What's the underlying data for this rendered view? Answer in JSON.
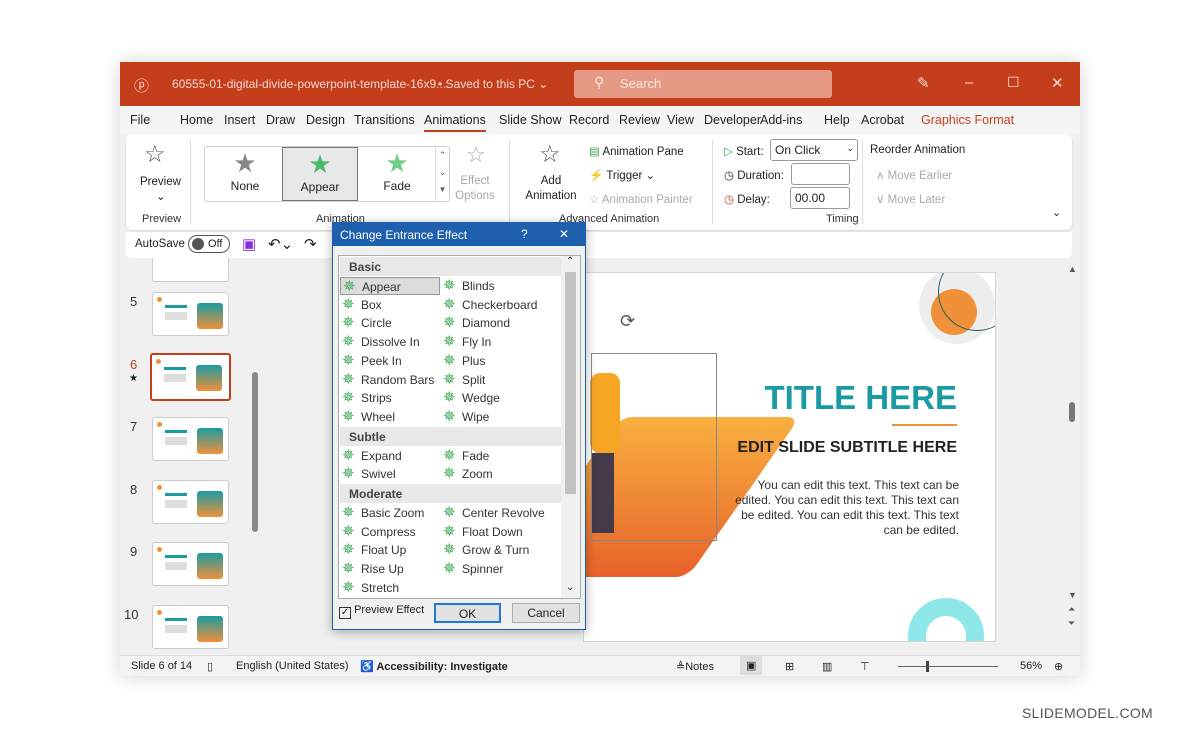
{
  "titlebar": {
    "filename": "60555-01-digital-divide-powerpoint-template-16x9....",
    "saved": "• Saved to this PC ⌄",
    "search_placeholder": "Search",
    "accent": "#c43e1c"
  },
  "tabs": [
    "File",
    "Home",
    "Insert",
    "Draw",
    "Design",
    "Transitions",
    "Animations",
    "Slide Show",
    "Record",
    "Review",
    "View",
    "Developer",
    "Add-ins",
    "Help",
    "Acrobat",
    "Graphics Format"
  ],
  "active_tab": "Animations",
  "ribbon": {
    "preview": {
      "label": "Preview",
      "group": "Preview"
    },
    "gallery": [
      {
        "label": "None"
      },
      {
        "label": "Appear",
        "selected": true
      },
      {
        "label": "Fade"
      }
    ],
    "effect_options": "Effect Options",
    "animation_group": "Animation",
    "add_animation": "Add Animation",
    "animation_pane": "Animation Pane",
    "trigger": "Trigger",
    "animation_painter": "Animation Painter",
    "advanced_group": "Advanced Animation",
    "start_label": "Start:",
    "start_value": "On Click",
    "duration_label": "Duration:",
    "duration_value": "",
    "delay_label": "Delay:",
    "delay_value": "00.00",
    "timing_group": "Timing",
    "reorder": "Reorder Animation",
    "move_earlier": "Move Earlier",
    "move_later": "Move Later"
  },
  "qat": {
    "autosave": "AutoSave",
    "toggle": "Off"
  },
  "thumbnails": [
    {
      "num": "5"
    },
    {
      "num": "6",
      "selected": true,
      "star": "★"
    },
    {
      "num": "7"
    },
    {
      "num": "8"
    },
    {
      "num": "9"
    },
    {
      "num": "10"
    }
  ],
  "slide": {
    "title": "TITLE HERE",
    "subtitle": "EDIT SLIDE SUBTITLE HERE",
    "body": "You can edit this text. This text can be edited. You can edit this text. This text can be edited. You can edit this text. This text can be edited.",
    "teal": "#1a9ba3",
    "orange": "#f0913a"
  },
  "dialog": {
    "title": "Change Entrance Effect",
    "help": "?",
    "close": "✕",
    "categories": [
      {
        "name": "Basic",
        "items": [
          [
            "Appear",
            "Blinds"
          ],
          [
            "Box",
            "Checkerboard"
          ],
          [
            "Circle",
            "Diamond"
          ],
          [
            "Dissolve In",
            "Fly In"
          ],
          [
            "Peek In",
            "Plus"
          ],
          [
            "Random Bars",
            "Split"
          ],
          [
            "Strips",
            "Wedge"
          ],
          [
            "Wheel",
            "Wipe"
          ]
        ]
      },
      {
        "name": "Subtle",
        "items": [
          [
            "Expand",
            "Fade"
          ],
          [
            "Swivel",
            "Zoom"
          ]
        ]
      },
      {
        "name": "Moderate",
        "items": [
          [
            "Basic Zoom",
            "Center Revolve"
          ],
          [
            "Compress",
            "Float Down"
          ],
          [
            "Float Up",
            "Grow & Turn"
          ],
          [
            "Rise Up",
            "Spinner"
          ],
          [
            "Stretch",
            ""
          ]
        ]
      }
    ],
    "selected": "Appear",
    "preview_effect": "Preview Effect",
    "preview_checked": true,
    "ok": "OK",
    "cancel": "Cancel"
  },
  "status": {
    "slide": "Slide 6 of 14",
    "language": "English (United States)",
    "accessibility": "Accessibility: Investigate",
    "notes": "Notes",
    "zoom": "56%"
  },
  "watermark": "SLIDEMODEL.COM"
}
